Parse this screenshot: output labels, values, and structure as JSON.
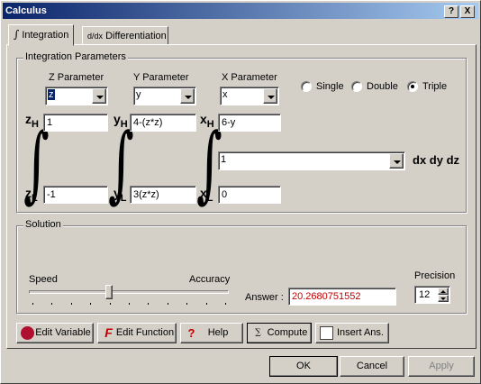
{
  "window": {
    "title": "Calculus",
    "help_btn": "?",
    "close_btn": "X"
  },
  "tabs": [
    {
      "label": "Integration",
      "active": true
    },
    {
      "label": "Differentiation",
      "active": false
    }
  ],
  "integration_params": {
    "group_label": "Integration Parameters",
    "z_param": {
      "label": "Z Parameter",
      "value": "z"
    },
    "y_param": {
      "label": "Y Parameter",
      "value": "y"
    },
    "x_param": {
      "label": "X Parameter",
      "value": "x"
    },
    "modes": {
      "single": "Single",
      "double": "Double",
      "triple": "Triple",
      "selected": "triple"
    },
    "limits": {
      "z_high_label": "z",
      "z_high_sub": "H",
      "z_high": "1",
      "z_low_label": "z",
      "z_low_sub": "L",
      "z_low": "-1",
      "y_high_label": "y",
      "y_high_sub": "H",
      "y_high": "4-(z*z)",
      "y_low_label": "y",
      "y_low_sub": "L",
      "y_low": "3(z*z)",
      "x_high_label": "x",
      "x_high_sub": "H",
      "x_high": "6-y",
      "x_low_label": "x",
      "x_low_sub": "L",
      "x_low": "0"
    },
    "function": "1",
    "differentials": "dx dy dz"
  },
  "solution": {
    "group_label": "Solution",
    "speed_label": "Speed",
    "accuracy_label": "Accuracy",
    "slider_position": 0.4,
    "answer_label": "Answer :",
    "answer": "20.2680751552",
    "precision_label": "Precision",
    "precision": "12"
  },
  "toolbar": {
    "edit_variable": "Edit Variable",
    "edit_function": "Edit Function",
    "help": "Help",
    "compute": "Compute",
    "insert_ans": "Insert Ans."
  },
  "footer": {
    "ok": "OK",
    "cancel": "Cancel",
    "apply": "Apply"
  },
  "colors": {
    "title_bar": "#0a246a",
    "answer_text": "#c00000",
    "face": "#d4d0c8"
  }
}
